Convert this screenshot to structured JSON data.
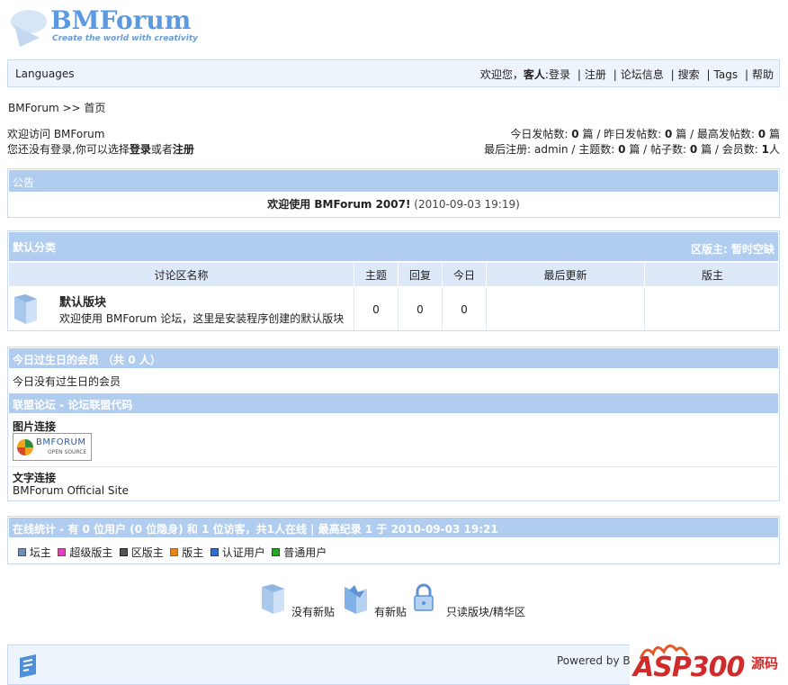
{
  "logo": {
    "title": "BMForum",
    "tagline": "Create the world with creativity"
  },
  "topnav": {
    "languages": "Languages",
    "welcome": "欢迎您，",
    "guest": "客人",
    "sep": ":",
    "login": "登录",
    "register": "注册",
    "info": "论坛信息",
    "search": "搜索",
    "tags": "Tags",
    "help": "帮助",
    "pipe": "|"
  },
  "breadcrumb": {
    "home": "BMForum",
    "arrow": ">>",
    "current": "首页"
  },
  "greet": {
    "line1": "欢迎访问 BMForum",
    "line2_a": "您还没有登录,你可以选择",
    "line2_login": "登录",
    "line2_or": "或者",
    "line2_register": "注册"
  },
  "stats": {
    "today_label": "今日发帖数:",
    "today": "0",
    "yest_label": "昨日发帖数:",
    "yest": "0",
    "max_label": "最高发帖数:",
    "max": "0",
    "unit": "篇",
    "last_reg_label": "最后注册:",
    "last_reg": "admin",
    "topics_label": "主题数:",
    "topics": "0",
    "posts_label": "帖子数:",
    "posts": "0",
    "members_label": "会员数:",
    "members": "1",
    "person": "人"
  },
  "notice": {
    "header": "公告",
    "text": "欢迎使用 BMForum 2007!",
    "date": "(2010-09-03 19:19)"
  },
  "category": {
    "title": "默认分类",
    "moderator": "区版主: 暂时空缺",
    "columns": [
      "讨论区名称",
      "主题",
      "回复",
      "今日",
      "最后更新",
      "版主"
    ],
    "forum": {
      "name": "默认版块",
      "desc": "欢迎使用 BMForum 论坛，这里是安装程序创建的默认版块",
      "topics": "0",
      "replies": "0",
      "today": "0"
    }
  },
  "birthday": {
    "header": "今日过生日的会员 （共 0 人）",
    "text": "今日没有过生日的会员"
  },
  "links": {
    "header": "联盟论坛 - 论坛联盟代码",
    "image_label": "图片连接",
    "logo_text": "BMFORUM",
    "logo_sub": "OPEN SOURCE",
    "text_label": "文字连接",
    "text_link": "BMForum Official Site"
  },
  "online": {
    "header": "在线统计 - 有 0 位用户 (0 位隐身) 和 1 位访客，共1人在线 | 最高纪录 1 于 2010-09-03 19:21",
    "legend": [
      {
        "label": "坛主",
        "color": "#6f8fb8"
      },
      {
        "label": "超级版主",
        "color": "#e23fc8"
      },
      {
        "label": "区版主",
        "color": "#555555"
      },
      {
        "label": "版主",
        "color": "#e8831a"
      },
      {
        "label": "认证用户",
        "color": "#2f6fd6"
      },
      {
        "label": "普通用户",
        "color": "#22aa22"
      }
    ]
  },
  "iconlegend": {
    "nonew": "没有新贴",
    "new": "有新贴",
    "readonly": "只读版块/精华区"
  },
  "footer": {
    "powered": "Powered by BM",
    "watermark": "ASP300",
    "watermark_cn": "源码"
  }
}
